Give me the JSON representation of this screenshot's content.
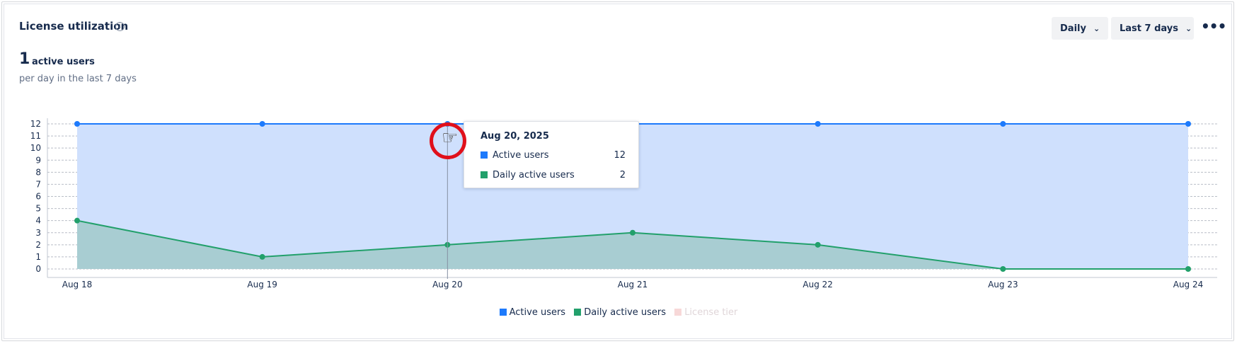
{
  "header": {
    "title": "License utilization",
    "info_icon": "info-icon",
    "big_number": "1",
    "big_label": "active users",
    "sub_label": "per day in the last 7 days"
  },
  "controls": {
    "interval_label": "Daily",
    "range_label": "Last 7 days",
    "more_icon": "more-horizontal-icon",
    "chevron_icon": "chevron-down-icon"
  },
  "chart_data": {
    "type": "area",
    "categories": [
      "Aug 18",
      "Aug 19",
      "Aug 20",
      "Aug 21",
      "Aug 22",
      "Aug 23",
      "Aug 24"
    ],
    "series": [
      {
        "name": "Active users",
        "values": [
          12,
          12,
          12,
          12,
          12,
          12,
          12
        ],
        "color": "#1d7afc",
        "fill": "#cfe0fd"
      },
      {
        "name": "Daily active users",
        "values": [
          4,
          1,
          2,
          3,
          2,
          0,
          0
        ],
        "color": "#22a06b",
        "fill": "#a8cdd2"
      },
      {
        "name": "License tier",
        "values": [],
        "color": "#f7d8d8"
      }
    ],
    "ylim": [
      0,
      12
    ],
    "yticks": [
      0,
      1,
      2,
      3,
      4,
      5,
      6,
      7,
      8,
      9,
      10,
      11,
      12
    ],
    "grid": true,
    "legend": "bottom-center"
  },
  "tooltip": {
    "date": "Aug 20, 2025",
    "rows": [
      {
        "label": "Active users",
        "value": "12",
        "color": "#1d7afc"
      },
      {
        "label": "Daily active users",
        "value": "2",
        "color": "#22a06b"
      }
    ]
  },
  "legend": {
    "items": [
      {
        "label": "Active users",
        "color": "#1d7afc"
      },
      {
        "label": "Daily active users",
        "color": "#22a06b"
      },
      {
        "label": "License tier",
        "color": "#f7d8d8"
      }
    ]
  }
}
